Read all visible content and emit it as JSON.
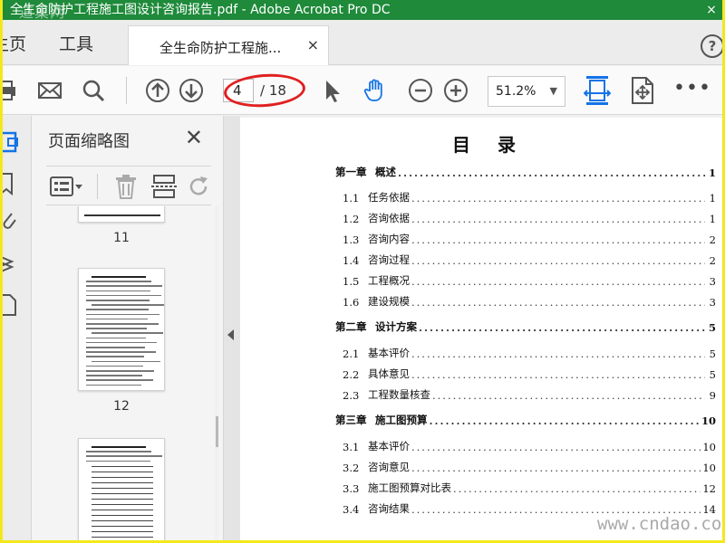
{
  "titlebar": {
    "title": "全生命防护工程施工图设计咨询报告.pdf - Adobe Acrobat Pro DC",
    "watermark": "道巢网",
    "close_label": "×"
  },
  "tabs": {
    "home": "主页",
    "tools": "工具",
    "document": "全生命防护工程施...",
    "close": "×",
    "help": "?"
  },
  "toolbar": {
    "current_page": "4",
    "total_pages": "/ 18",
    "zoom": "51.2%",
    "zoom_caret": "▼",
    "more": "•••"
  },
  "thumbnails": {
    "title": "页面缩略图",
    "close": "✕",
    "pages": [
      "11",
      "12"
    ]
  },
  "toc": {
    "title": "目录",
    "rows": [
      {
        "num": "第一章",
        "text": "概述",
        "page": "1",
        "chapter": true
      },
      {
        "num": "1.1",
        "text": "任务依据",
        "page": "1",
        "chapter": false
      },
      {
        "num": "1.2",
        "text": "咨询依据",
        "page": "1",
        "chapter": false
      },
      {
        "num": "1.3",
        "text": "咨询内容",
        "page": "2",
        "chapter": false
      },
      {
        "num": "1.4",
        "text": "咨询过程",
        "page": "2",
        "chapter": false
      },
      {
        "num": "1.5",
        "text": "工程概况",
        "page": "3",
        "chapter": false
      },
      {
        "num": "1.6",
        "text": "建设规模",
        "page": "3",
        "chapter": false
      },
      {
        "num": "第二章",
        "text": "设计方案",
        "page": "5",
        "chapter": true
      },
      {
        "num": "2.1",
        "text": "基本评价",
        "page": "5",
        "chapter": false
      },
      {
        "num": "2.2",
        "text": "具体意见",
        "page": "5",
        "chapter": false
      },
      {
        "num": "2.3",
        "text": "工程数量核查",
        "page": "9",
        "chapter": false
      },
      {
        "num": "第三章",
        "text": "施工图预算",
        "page": "10",
        "chapter": true
      },
      {
        "num": "3.1",
        "text": "基本评价",
        "page": "10",
        "chapter": false
      },
      {
        "num": "3.2",
        "text": "咨询意见",
        "page": "10",
        "chapter": false
      },
      {
        "num": "3.3",
        "text": "施工图预算对比表",
        "page": "12",
        "chapter": false
      },
      {
        "num": "3.4",
        "text": "咨询结果",
        "page": "14",
        "chapter": false
      }
    ]
  },
  "watermark_br": "www.cndao.com",
  "colors": {
    "titlebar": "#1e8a3a",
    "accent_blue": "#1473e6",
    "highlight": "#e02020",
    "frame": "#f3e81c"
  }
}
